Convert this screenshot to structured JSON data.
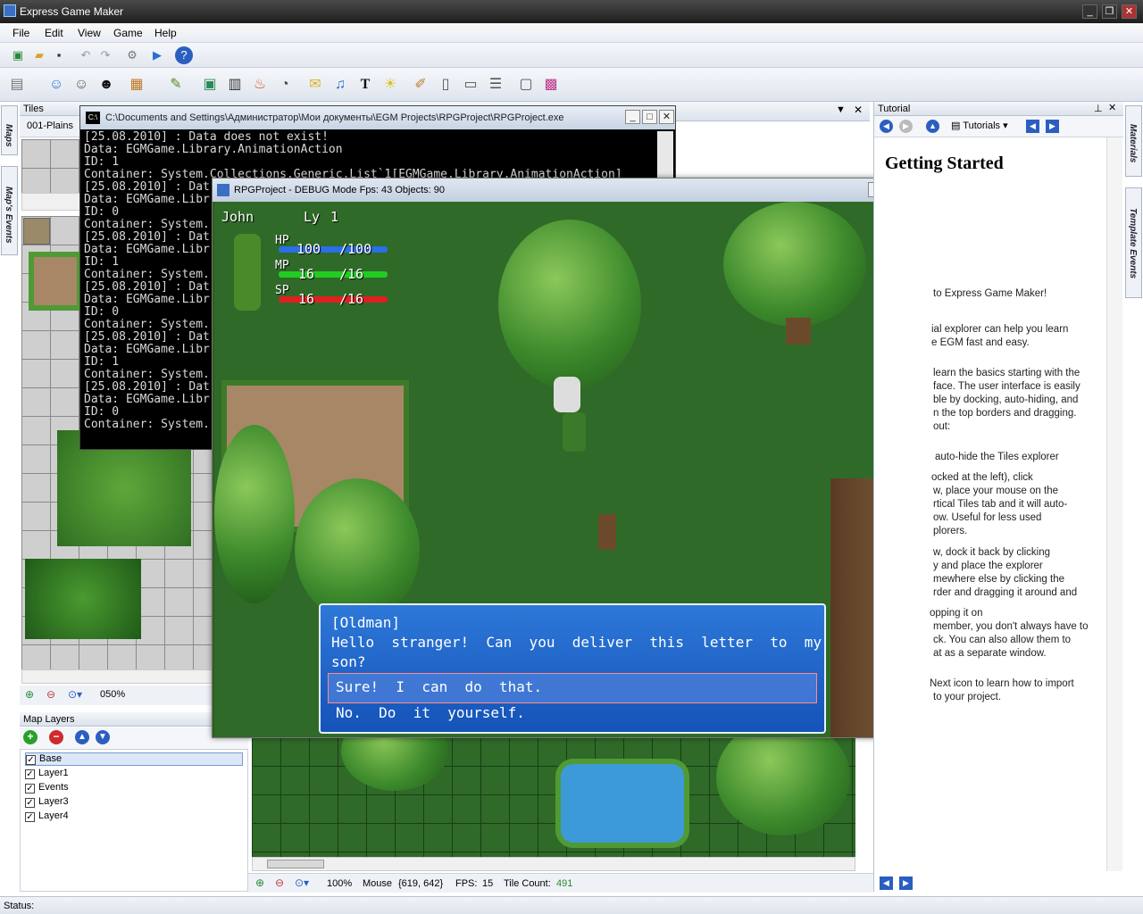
{
  "window": {
    "title": "Express Game Maker"
  },
  "menu": [
    "File",
    "Edit",
    "View",
    "Game",
    "Help"
  ],
  "side_tabs": [
    "Maps",
    "Map's Events"
  ],
  "right_side_tabs": [
    "Materials",
    "Template Events"
  ],
  "tiles_panel": {
    "header": "Tiles",
    "tileset": "001-Plains",
    "zoom": "050%"
  },
  "map_layers": {
    "header": "Map Layers",
    "layers": [
      {
        "name": "Base",
        "checked": true,
        "selected": true
      },
      {
        "name": "Layer1",
        "checked": true
      },
      {
        "name": "Events",
        "checked": true
      },
      {
        "name": "Layer3",
        "checked": true
      },
      {
        "name": "Layer4",
        "checked": true
      }
    ]
  },
  "console": {
    "title": "C:\\Documents and Settings\\Администратор\\Мои документы\\EGM Projects\\RPGProject\\RPGProject.exe",
    "lines": [
      "[25.08.2010] : Data does not exist!",
      "Data: EGMGame.Library.AnimationAction",
      "ID: 1",
      "Container: System.Collections.Generic.List`1[EGMGame.Library.AnimationAction]",
      "[25.08.2010] : Dat",
      "Data: EGMGame.Libr",
      "ID: 0",
      "Container: System.",
      "[25.08.2010] : Dat",
      "Data: EGMGame.Libr",
      "ID: 1",
      "Container: System.",
      "[25.08.2010] : Dat",
      "Data: EGMGame.Libr",
      "ID: 0",
      "Container: System.",
      "[25.08.2010] : Dat",
      "Data: EGMGame.Libr",
      "ID: 1",
      "Container: System.",
      "[25.08.2010] : Dat",
      "Data: EGMGame.Libr",
      "ID: 0",
      "Container: System."
    ]
  },
  "game": {
    "title": "RPGProject - DEBUG Mode Fps: 43 Objects: 90",
    "hud": {
      "name": "John",
      "level_label": "Ly",
      "level": "1",
      "hp_label": "HP",
      "hp": "100",
      "hp_max": "/100",
      "mp_label": "MP",
      "mp": "16",
      "mp_max": "/16",
      "sp_label": "SP",
      "sp": "16",
      "sp_max": "/16"
    },
    "dialog": {
      "speaker": "[Oldman]",
      "line1": "Hello  stranger!  Can  you  deliver  this  letter  to  my",
      "line2": "son?",
      "choice1": "Sure!  I  can  do  that.",
      "choice2": "No.  Do  it  yourself."
    }
  },
  "map_view": {
    "zoom": "100%",
    "mouse_label": "Mouse",
    "mouse_value": "{619, 642}",
    "fps_label": "FPS:",
    "fps_value": "15",
    "tile_count_label": "Tile Count:",
    "tile_count_value": "491"
  },
  "tutorial": {
    "header": "Tutorial",
    "dropdown": "Tutorials",
    "heading": "Getting Started",
    "lines": [
      "to Express Game Maker!",
      "ial explorer can help you learn",
      "e EGM fast and easy.",
      "learn the basics starting with the",
      "face. The user interface is easily",
      "ble by docking, auto-hiding, and",
      "n the top borders and dragging.",
      "out:",
      "auto-hide the Tiles explorer",
      "ocked at the left), click",
      "w, place your mouse on the",
      "rtical Tiles tab and it will auto-",
      "ow. Useful for less used",
      "plorers.",
      "w, dock it back by clicking",
      "y and place the explorer",
      "mewhere else by clicking the",
      "rder and dragging it around and",
      "opping it on",
      "member, you don't always have to",
      "ck. You can also allow them to",
      "at as a separate window.",
      "Next icon to learn how to import",
      "to your project."
    ]
  },
  "status": {
    "label": "Status:"
  },
  "colors": {
    "tile_count": "#2a8a2a",
    "dialog_bg": "#1f63c8",
    "hp": "#2b6fe8",
    "mp": "#22cc22",
    "sp": "#e02020"
  }
}
